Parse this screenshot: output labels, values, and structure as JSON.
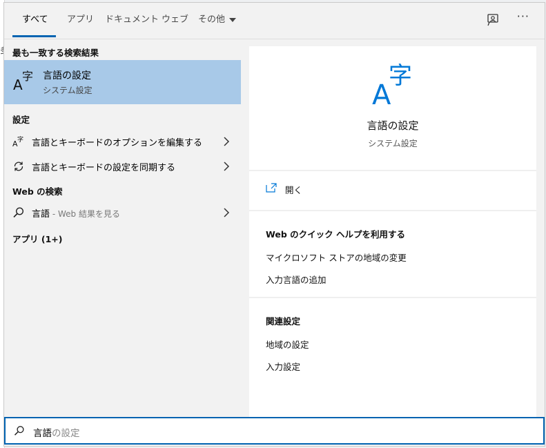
{
  "background": {
    "edge_char": "多"
  },
  "tabs": [
    {
      "label": "すべて",
      "active": true
    },
    {
      "label": "アプリ",
      "active": false
    },
    {
      "label": "ドキュメント",
      "active": false
    },
    {
      "label": "ウェブ",
      "active": false
    },
    {
      "label": "その他",
      "active": false
    }
  ],
  "header_icons": {
    "feedback": "feedback-icon",
    "more": "···"
  },
  "left": {
    "best_match_title": "最も一致する検索結果",
    "best_match": {
      "title": "言語の設定",
      "subtitle": "システム設定",
      "icon": "language-icon"
    },
    "settings_title": "設定",
    "settings_items": [
      {
        "label": "言語とキーボードのオプションを編集する",
        "icon": "language-icon"
      },
      {
        "label": "言語とキーボードの設定を同期する",
        "icon": "sync-icon"
      }
    ],
    "web_title": "Web の検索",
    "web_item": {
      "label": "言語",
      "suffix": " - Web 結果を見る",
      "icon": "search-icon"
    },
    "apps_title": "アプリ (1+)"
  },
  "right": {
    "title": "言語の設定",
    "subtitle": "システム設定",
    "open_label": "開く",
    "web_help_title": "Web のクイック ヘルプを利用する",
    "web_help_links": [
      "マイクロソフト ストアの地域の変更",
      "入力言語の追加"
    ],
    "related_title": "関連設定",
    "related_links": [
      "地域の設定",
      "入力設定"
    ]
  },
  "search": {
    "typed": "言語",
    "completion": "の設定"
  },
  "colors": {
    "accent": "#0063b1",
    "selection": "#a8c9e8",
    "icon_blue": "#0078d7"
  }
}
